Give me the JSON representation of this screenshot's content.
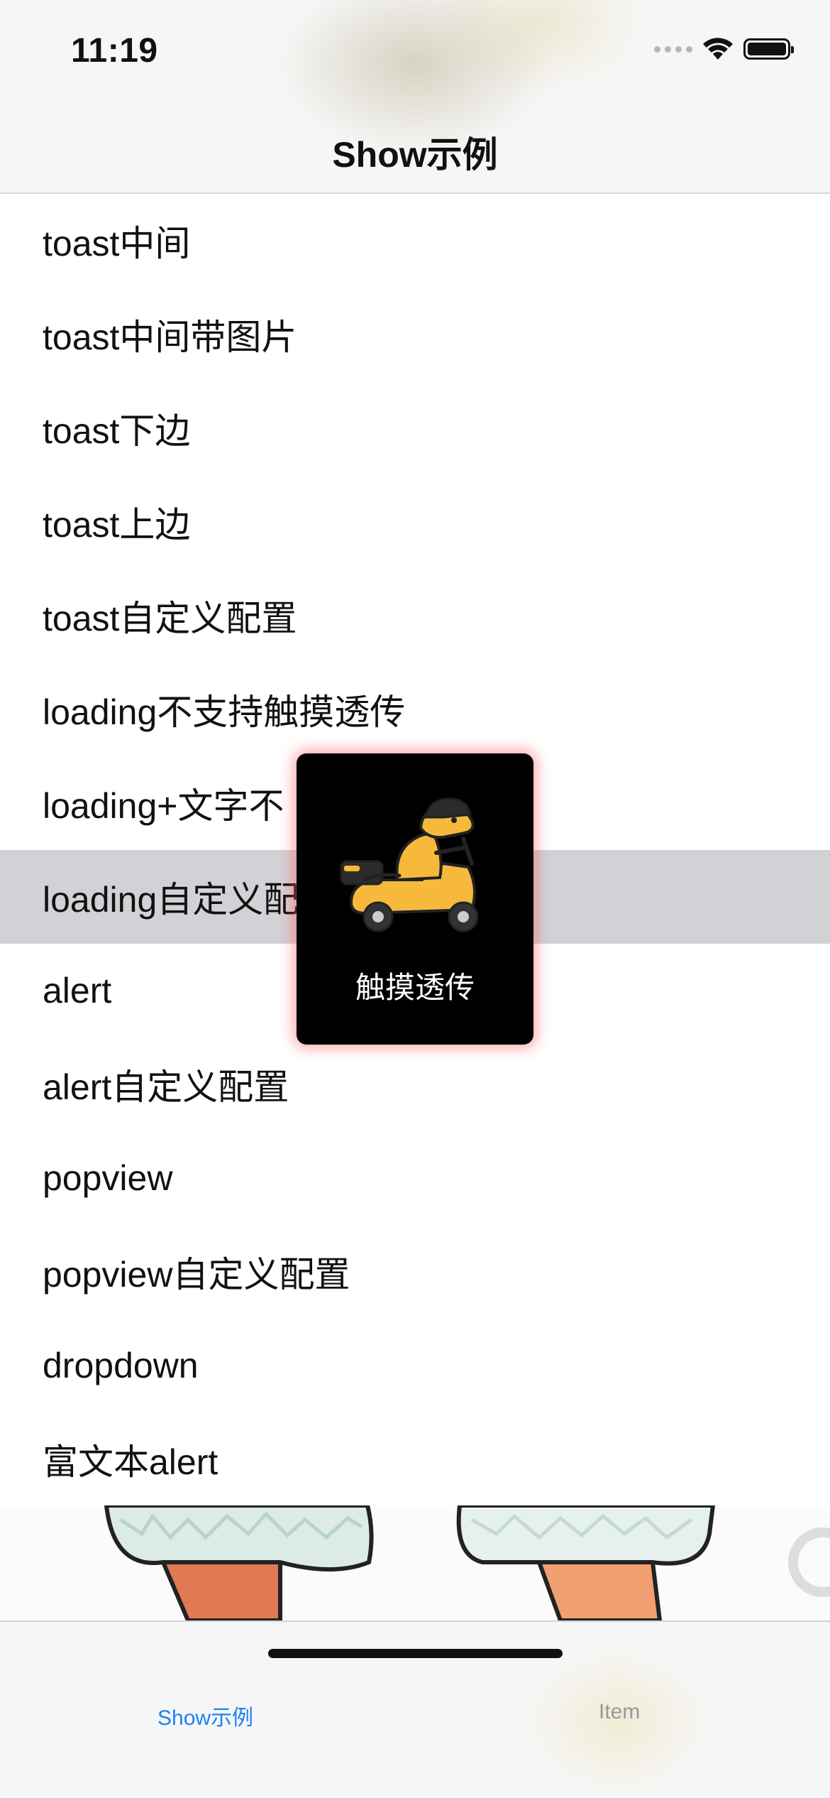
{
  "status_bar": {
    "time": "11:19"
  },
  "nav": {
    "title": "Show示例"
  },
  "list": {
    "items": [
      "toast中间",
      "toast中间带图片",
      "toast下边",
      "toast上边",
      "toast自定义配置",
      "loading不支持触摸透传",
      "loading+文字不",
      "loading自定义配",
      "alert",
      "alert自定义配置",
      "popview",
      "popview自定义配置",
      "dropdown",
      "富文本alert"
    ],
    "selected_index": 7
  },
  "hud": {
    "label": "触摸透传",
    "icon": "kangaroo-scooter-icon"
  },
  "tab_bar": {
    "tabs": [
      {
        "label": "Show示例",
        "active": true
      },
      {
        "label": "Item",
        "active": false
      }
    ]
  },
  "colors": {
    "accent": "#1a82f6",
    "selected_row": "#d1d1d6",
    "hud_bg": "#000000"
  }
}
